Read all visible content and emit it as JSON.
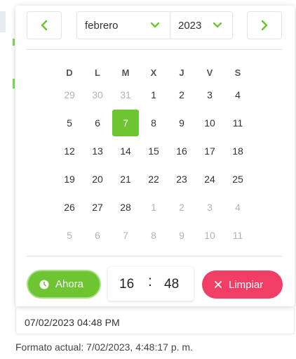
{
  "nav": {
    "prev_icon": "chevron-left-icon",
    "next_icon": "chevron-right-icon",
    "accent": "#6cc531"
  },
  "selects": {
    "month": "febrero",
    "year": "2023"
  },
  "weekdays": [
    "D",
    "L",
    "M",
    "X",
    "J",
    "V",
    "S"
  ],
  "days": [
    {
      "n": "29",
      "muted": true
    },
    {
      "n": "30",
      "muted": true
    },
    {
      "n": "31",
      "muted": true
    },
    {
      "n": "1"
    },
    {
      "n": "2"
    },
    {
      "n": "3"
    },
    {
      "n": "4"
    },
    {
      "n": "5"
    },
    {
      "n": "6"
    },
    {
      "n": "7",
      "selected": true
    },
    {
      "n": "8"
    },
    {
      "n": "9"
    },
    {
      "n": "10"
    },
    {
      "n": "11"
    },
    {
      "n": "12"
    },
    {
      "n": "13"
    },
    {
      "n": "14"
    },
    {
      "n": "15"
    },
    {
      "n": "16"
    },
    {
      "n": "17"
    },
    {
      "n": "18"
    },
    {
      "n": "19"
    },
    {
      "n": "20"
    },
    {
      "n": "21"
    },
    {
      "n": "22"
    },
    {
      "n": "23"
    },
    {
      "n": "24"
    },
    {
      "n": "25"
    },
    {
      "n": "26"
    },
    {
      "n": "27"
    },
    {
      "n": "28"
    },
    {
      "n": "1",
      "muted": true
    },
    {
      "n": "2",
      "muted": true
    },
    {
      "n": "3",
      "muted": true
    },
    {
      "n": "4",
      "muted": true
    },
    {
      "n": "5",
      "muted": true
    },
    {
      "n": "6",
      "muted": true
    },
    {
      "n": "7",
      "muted": true
    },
    {
      "n": "8",
      "muted": true
    },
    {
      "n": "9",
      "muted": true
    },
    {
      "n": "10",
      "muted": true
    },
    {
      "n": "11",
      "muted": true
    }
  ],
  "footer": {
    "now_label": "Ahora",
    "hours": "16",
    "separator": ":",
    "minutes": "48",
    "clear_label": "Limpiar",
    "now_color": "#6cc531",
    "clear_color": "#f03e65"
  },
  "field": {
    "value": "07/02/2023 04:48 PM"
  },
  "format_line": "Formato actual: 7/02/2023, 4:48:17 p. m."
}
